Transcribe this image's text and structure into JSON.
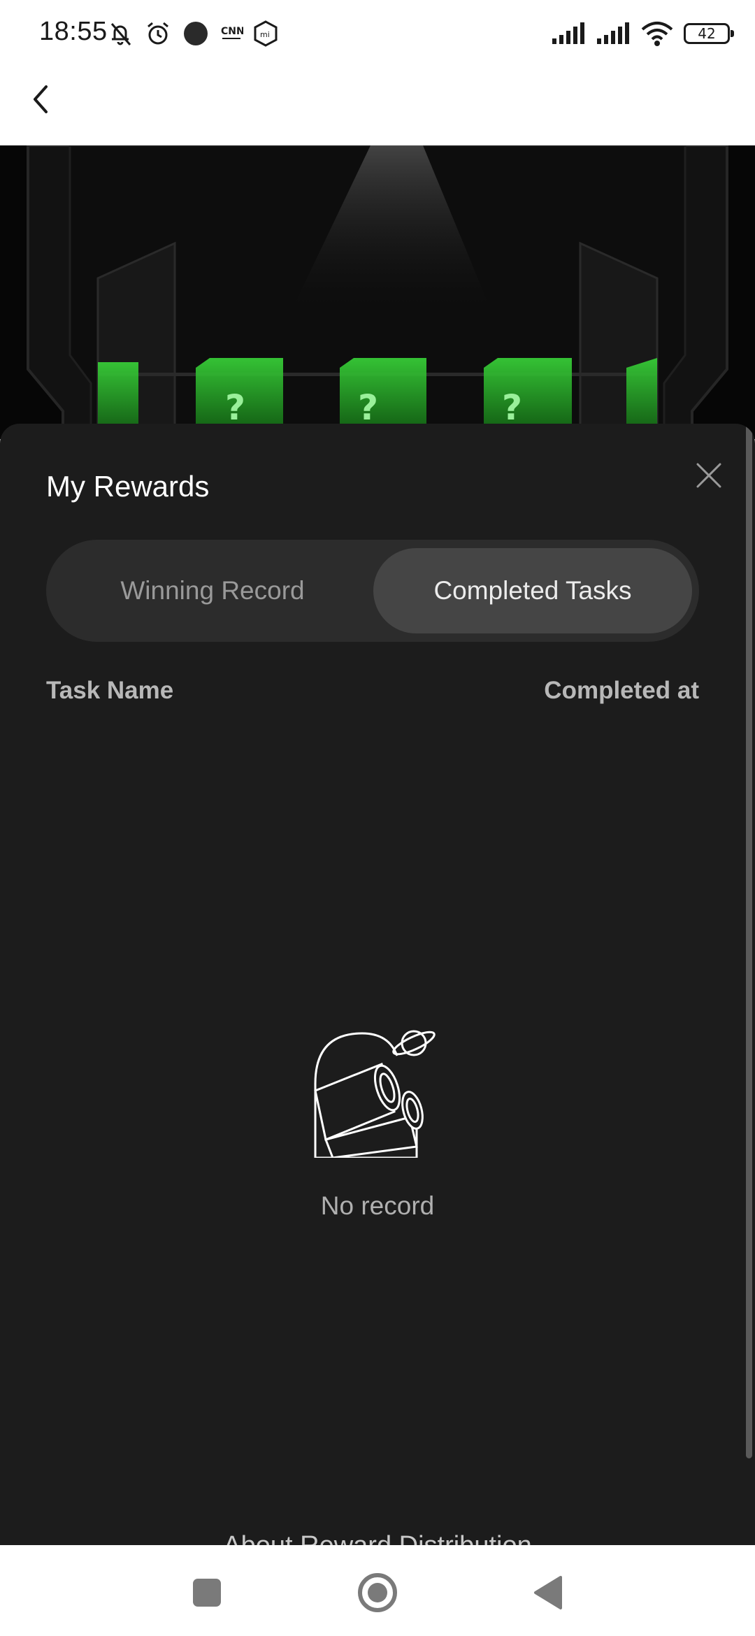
{
  "status_bar": {
    "time": "18:55",
    "battery": "42",
    "icons": [
      "bell-off-icon",
      "alarm-icon",
      "dot-icon",
      "cnn-indonesia-icon",
      "mi-icon",
      "signal-icon",
      "signal-icon",
      "wifi-icon",
      "battery-icon"
    ]
  },
  "header": {
    "back_icon": "chevron-left-icon"
  },
  "sheet": {
    "title": "My Rewards",
    "close_icon": "close-icon",
    "tabs": [
      {
        "label": "Winning Record",
        "active": false
      },
      {
        "label": "Completed Tasks",
        "active": true
      }
    ],
    "columns": {
      "task_name": "Task Name",
      "completed_at": "Completed at"
    },
    "empty_icon": "binoculars-planet-icon",
    "empty_text": "No record",
    "about_link": "About Reward Distribution"
  },
  "nav_bar": {
    "icons": [
      "recents-square-icon",
      "home-circle-icon",
      "back-triangle-icon"
    ]
  },
  "colors": {
    "sheet_bg": "#1c1c1c",
    "tab_active_bg": "#454545",
    "hero_accent": "#2bbd2b"
  }
}
